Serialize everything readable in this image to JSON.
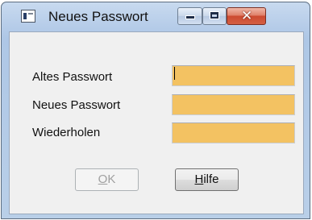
{
  "window": {
    "title": "Neues Passwort",
    "icon": "app-window-icon"
  },
  "caption_buttons": {
    "minimize_icon": "minimize-icon",
    "maximize_icon": "maximize-icon",
    "close_glyph": "✕"
  },
  "form": {
    "old_password": {
      "label": "Altes Passwort",
      "value": ""
    },
    "new_password": {
      "label": "Neues Passwort",
      "value": ""
    },
    "repeat_password": {
      "label": "Wiederholen",
      "value": ""
    }
  },
  "buttons": {
    "ok": {
      "mnemonic": "O",
      "rest": "K",
      "enabled": false
    },
    "help": {
      "mnemonic": "H",
      "rest": "ilfe",
      "enabled": true
    }
  },
  "colors": {
    "field_background": "#f3c262",
    "client_background": "#f0f0f0",
    "titlebar": "#b7cde9",
    "close_button": "#cc4a30"
  }
}
